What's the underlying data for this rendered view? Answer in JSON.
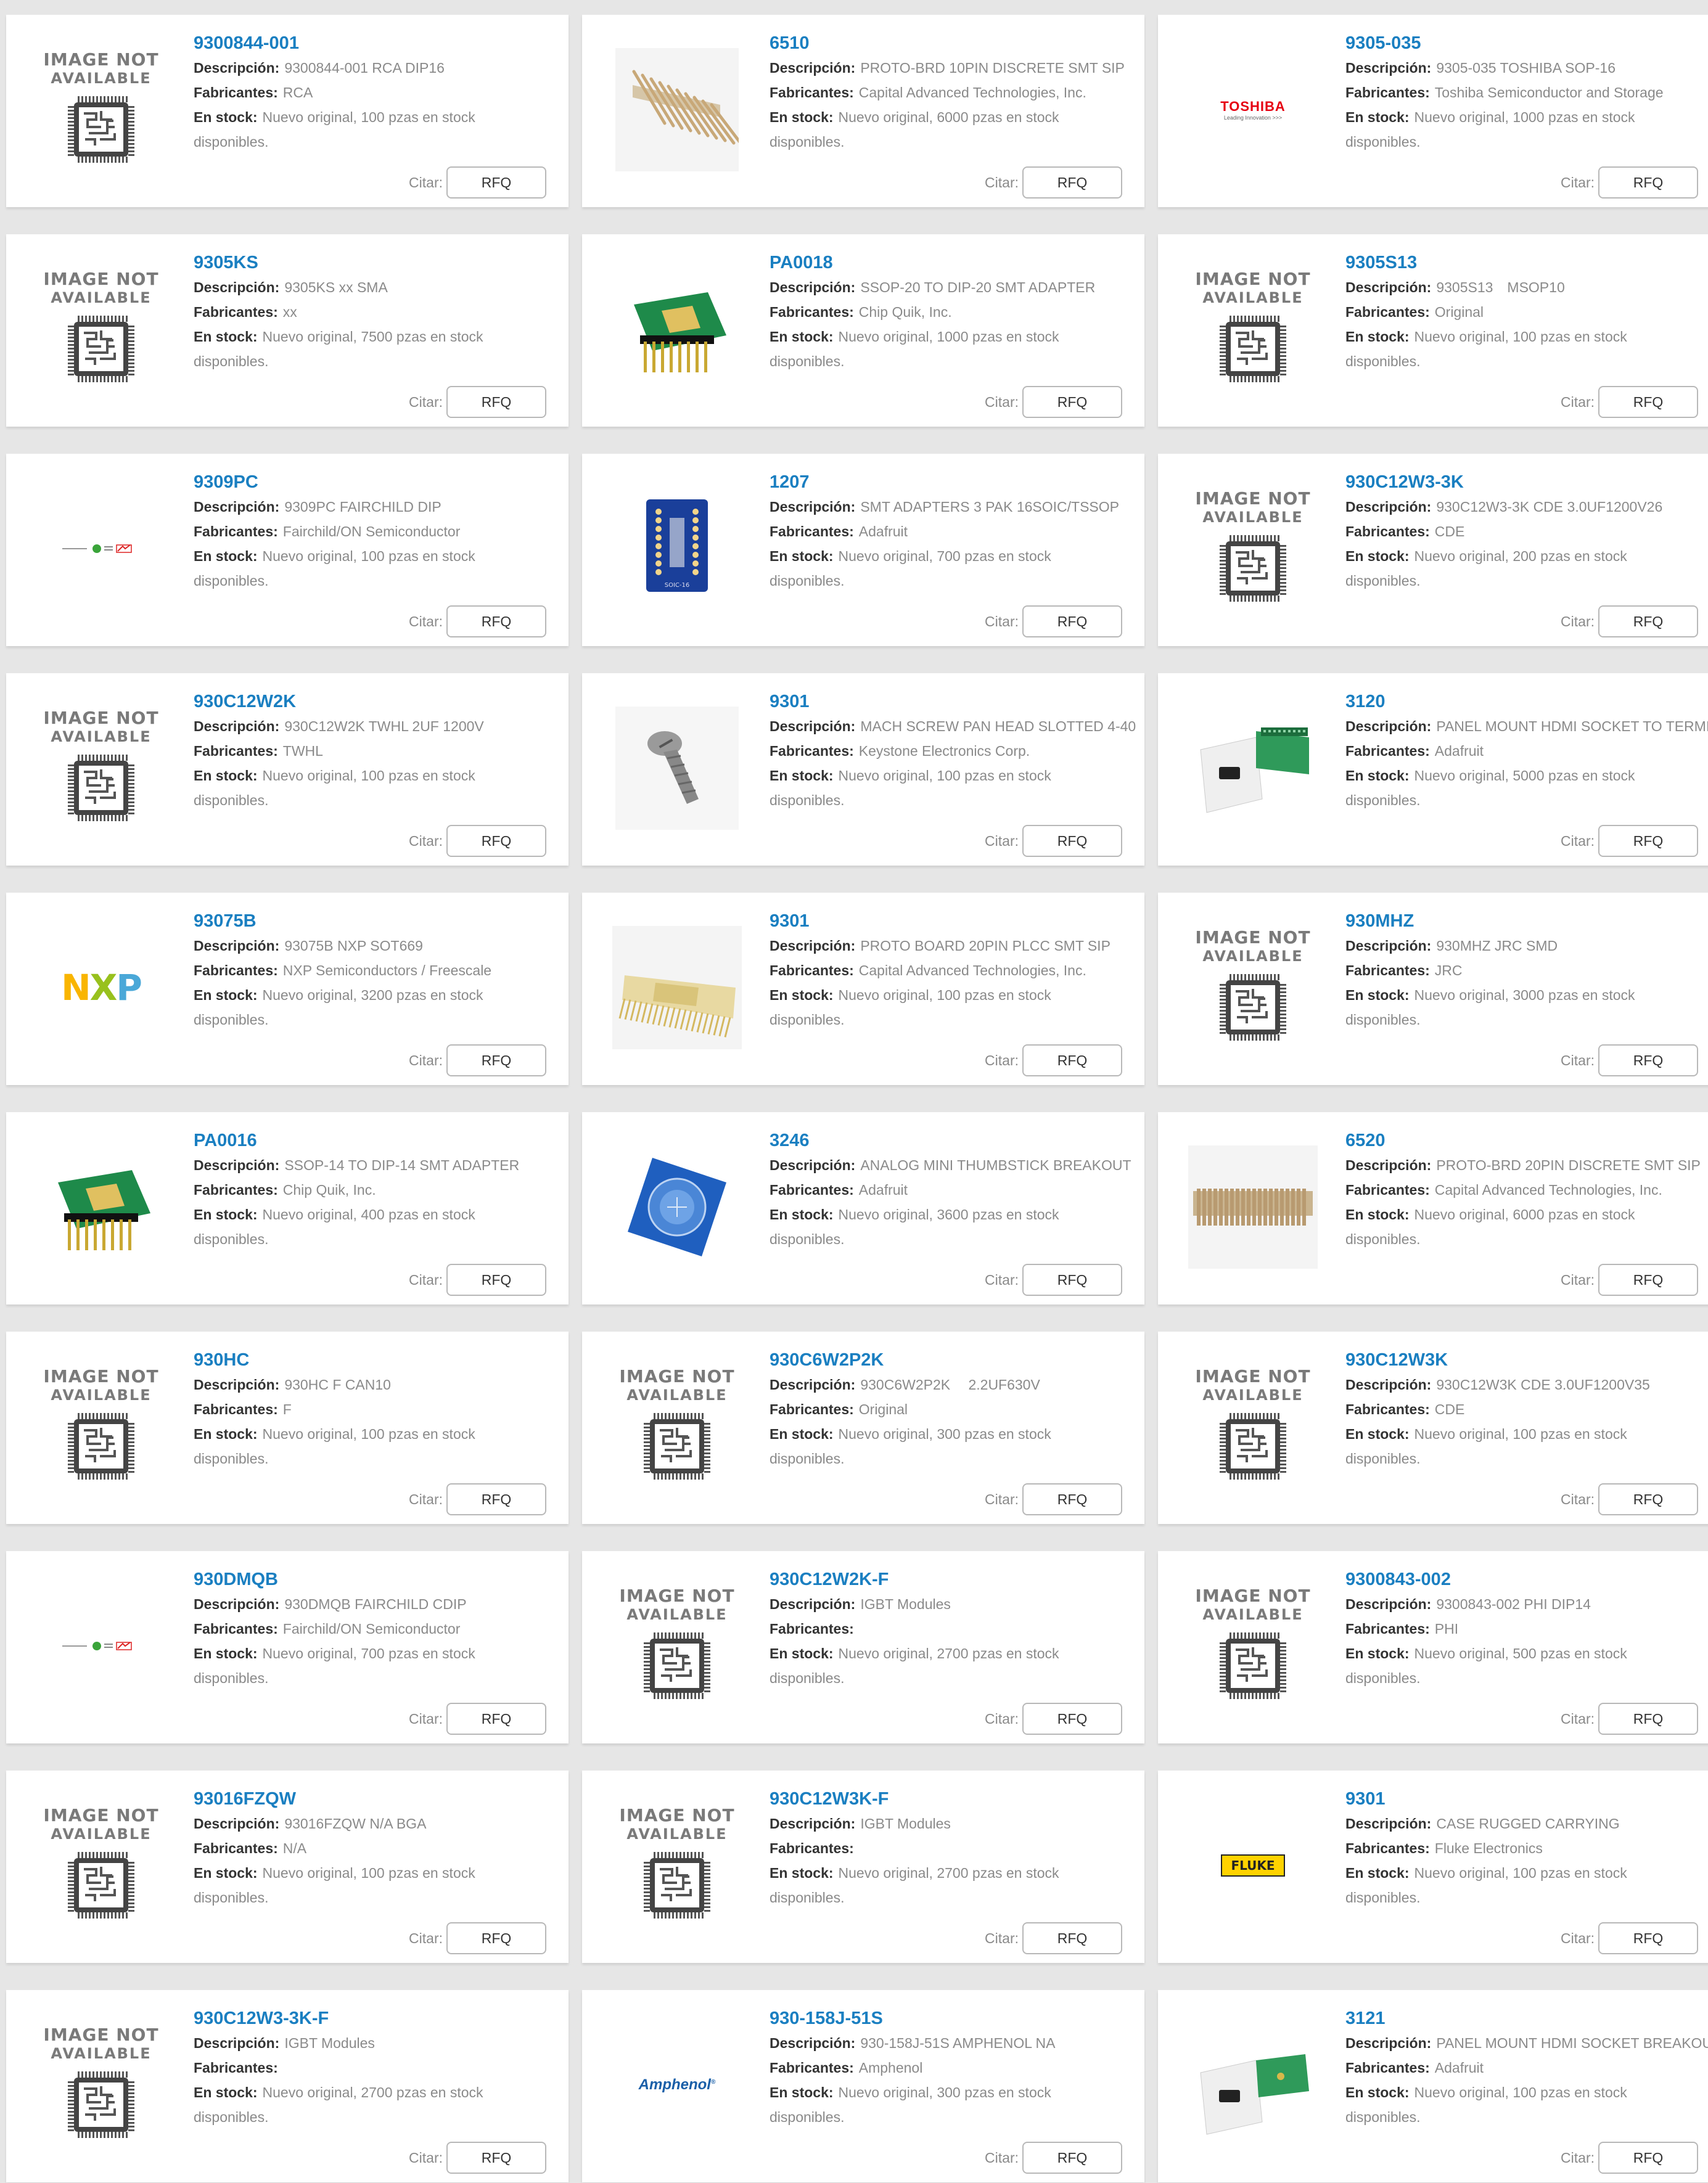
{
  "labels": {
    "description": "Descripción:",
    "manufacturer": "Fabricantes:",
    "stock": "En stock:",
    "cite": "Citar:",
    "rfq": "RFQ",
    "image_na_line1": "IMAGE NOT",
    "image_na_line2": "AVAILABLE"
  },
  "products": [
    {
      "part": "9300844-001",
      "description": "9300844-001 RCA DIP16",
      "manufacturer": "RCA",
      "stock": "Nuevo original, 100 pzas en stock disponibles.",
      "image": "not-available"
    },
    {
      "part": "6510",
      "description": "PROTO-BRD 10PIN DISCRETE SMT SIP",
      "manufacturer": "Capital Advanced Technologies, Inc.",
      "stock": "Nuevo original, 6000 pzas en stock disponibles.",
      "image": "proto-board-pins"
    },
    {
      "part": "9305-035",
      "description": "9305-035 TOSHIBA SOP-16",
      "manufacturer": "Toshiba Semiconductor and Storage",
      "stock": "Nuevo original, 1000 pzas en stock disponibles.",
      "image": "toshiba-logo",
      "logo_text": "TOSHIBA",
      "logo_sub": "Leading Innovation >>>"
    },
    {
      "part": "9305KS",
      "description": "9305KS xx SMA",
      "manufacturer": "xx",
      "stock": "Nuevo original, 7500 pzas en stock disponibles.",
      "image": "not-available"
    },
    {
      "part": "PA0018",
      "description": "SSOP-20 TO DIP-20 SMT ADAPTER",
      "manufacturer": "Chip Quik, Inc.",
      "stock": "Nuevo original, 1000 pzas en stock disponibles.",
      "image": "green-adapter-board"
    },
    {
      "part": "9305S13",
      "description": "9305S13　MSOP10",
      "manufacturer": "Original",
      "stock": "Nuevo original, 100 pzas en stock disponibles.",
      "image": "not-available"
    },
    {
      "part": "9309PC",
      "description": "9309PC FAIRCHILD DIP",
      "manufacturer": "Fairchild/ON Semiconductor",
      "stock": "Nuevo original, 100 pzas en stock disponibles.",
      "image": "fairchild-on-logo"
    },
    {
      "part": "1207",
      "description": "SMT ADAPTERS 3 PAK 16SOIC/TSSOP",
      "manufacturer": "Adafruit",
      "stock": "Nuevo original, 700 pzas en stock disponibles.",
      "image": "blue-breakout-board",
      "silk_text": "SOIC-16"
    },
    {
      "part": "930C12W3-3K",
      "description": "930C12W3-3K CDE 3.0UF1200V26",
      "manufacturer": "CDE",
      "stock": "Nuevo original, 200 pzas en stock disponibles.",
      "image": "not-available"
    },
    {
      "part": "930C12W2K",
      "description": "930C12W2K TWHL 2UF 1200V",
      "manufacturer": "TWHL",
      "stock": "Nuevo original, 100 pzas en stock disponibles.",
      "image": "not-available"
    },
    {
      "part": "9301",
      "description": "MACH SCREW PAN HEAD SLOTTED 4-40",
      "manufacturer": "Keystone Electronics Corp.",
      "stock": "Nuevo original, 100 pzas en stock disponibles.",
      "image": "screw"
    },
    {
      "part": "3120",
      "description": "PANEL MOUNT HDMI SOCKET TO TERMI",
      "manufacturer": "Adafruit",
      "stock": "Nuevo original, 5000 pzas en stock disponibles.",
      "image": "hdmi-panel-terminal"
    },
    {
      "part": "93075B",
      "description": "93075B NXP SOT669",
      "manufacturer": "NXP Semiconductors / Freescale",
      "stock": "Nuevo original, 3200 pzas en stock disponibles.",
      "image": "nxp-logo",
      "logo_text": "NXP"
    },
    {
      "part": "9301",
      "description": "PROTO BOARD 20PIN PLCC SMT SIP",
      "manufacturer": "Capital Advanced Technologies, Inc.",
      "stock": "Nuevo original, 100 pzas en stock disponibles.",
      "image": "plcc-proto-board"
    },
    {
      "part": "930MHZ",
      "description": "930MHZ JRC SMD",
      "manufacturer": "JRC",
      "stock": "Nuevo original, 3000 pzas en stock disponibles.",
      "image": "not-available"
    },
    {
      "part": "PA0016",
      "description": "SSOP-14 TO DIP-14 SMT ADAPTER",
      "manufacturer": "Chip Quik, Inc.",
      "stock": "Nuevo original, 400 pzas en stock disponibles.",
      "image": "green-adapter-board"
    },
    {
      "part": "3246",
      "description": "ANALOG MINI THUMBSTICK BREAKOUT",
      "manufacturer": "Adafruit",
      "stock": "Nuevo original, 3600 pzas en stock disponibles.",
      "image": "thumbstick-breakout"
    },
    {
      "part": "6520",
      "description": "PROTO-BRD 20PIN DISCRETE SMT SIP",
      "manufacturer": "Capital Advanced Technologies, Inc.",
      "stock": "Nuevo original, 6000 pzas en stock disponibles.",
      "image": "proto-board-strip"
    },
    {
      "part": "930HC",
      "description": "930HC F CAN10",
      "manufacturer": "F",
      "stock": "Nuevo original, 100 pzas en stock disponibles.",
      "image": "not-available"
    },
    {
      "part": "930C6W2P2K",
      "description": "930C6W2P2K　 2.2UF630V",
      "manufacturer": "Original",
      "stock": "Nuevo original, 300 pzas en stock disponibles.",
      "image": "not-available"
    },
    {
      "part": "930C12W3K",
      "description": "930C12W3K CDE 3.0UF1200V35",
      "manufacturer": "CDE",
      "stock": "Nuevo original, 100 pzas en stock disponibles.",
      "image": "not-available"
    },
    {
      "part": "930DMQB",
      "description": "930DMQB FAIRCHILD CDIP",
      "manufacturer": "Fairchild/ON Semiconductor",
      "stock": "Nuevo original, 700 pzas en stock disponibles.",
      "image": "fairchild-on-logo"
    },
    {
      "part": "930C12W2K-F",
      "description": "IGBT Modules",
      "manufacturer": "",
      "stock": "Nuevo original, 2700 pzas en stock disponibles.",
      "image": "not-available"
    },
    {
      "part": "9300843-002",
      "description": "9300843-002 PHI DIP14",
      "manufacturer": "PHI",
      "stock": "Nuevo original, 500 pzas en stock disponibles.",
      "image": "not-available"
    },
    {
      "part": "93016FZQW",
      "description": "93016FZQW N/A BGA",
      "manufacturer": "N/A",
      "stock": "Nuevo original, 100 pzas en stock disponibles.",
      "image": "not-available"
    },
    {
      "part": "930C12W3K-F",
      "description": "IGBT Modules",
      "manufacturer": "",
      "stock": "Nuevo original, 2700 pzas en stock disponibles.",
      "image": "not-available"
    },
    {
      "part": "9301",
      "description": "CASE RUGGED CARRYING",
      "manufacturer": "Fluke Electronics",
      "stock": "Nuevo original, 100 pzas en stock disponibles.",
      "image": "fluke-logo",
      "logo_text": "FLUKE"
    },
    {
      "part": "930C12W3-3K-F",
      "description": "IGBT Modules",
      "manufacturer": "",
      "stock": "Nuevo original, 2700 pzas en stock disponibles.",
      "image": "not-available"
    },
    {
      "part": "930-158J-51S",
      "description": "930-158J-51S AMPHENOL NA",
      "manufacturer": "Amphenol",
      "stock": "Nuevo original, 300 pzas en stock disponibles.",
      "image": "amphenol-logo",
      "logo_text": "Amphenol"
    },
    {
      "part": "3121",
      "description": "PANEL MOUNT HDMI SOCKET BREAKOUT",
      "manufacturer": "Adafruit",
      "stock": "Nuevo original, 100 pzas en stock disponibles.",
      "image": "hdmi-panel-breakout"
    }
  ],
  "colors": {
    "page_bg": "#e6e6e6",
    "link": "#1a7fc1",
    "label": "#333333",
    "value": "#8a8a8a",
    "card_bg": "#ffffff"
  }
}
